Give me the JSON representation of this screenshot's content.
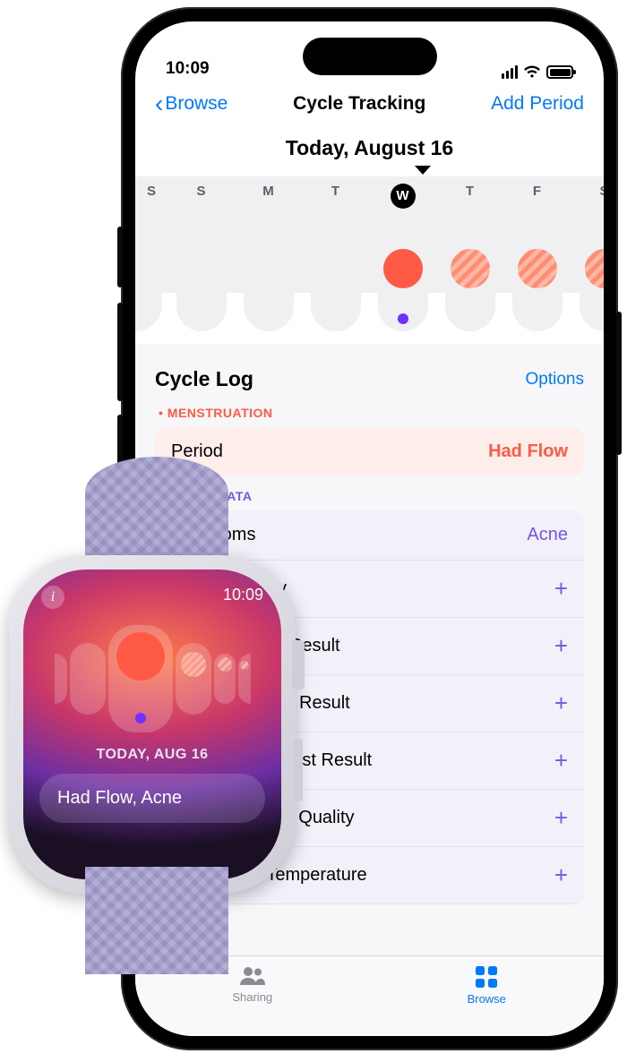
{
  "phone": {
    "status": {
      "time": "10:09"
    },
    "nav": {
      "back": "Browse",
      "title": "Cycle Tracking",
      "action": "Add Period"
    },
    "dateHeading": "Today, August 16",
    "dayLabels": [
      "S",
      "S",
      "M",
      "T",
      "W",
      "T",
      "F",
      "S"
    ],
    "selectedIndex": 4,
    "cycleLog": {
      "title": "Cycle Log",
      "options": "Options",
      "menstruationLabel": "MENSTRUATION",
      "periodRow": {
        "label": "Period",
        "value": "Had Flow"
      },
      "otherLabel": "OTHER DATA",
      "rows": [
        {
          "label": "Symptoms",
          "value": "Acne"
        },
        {
          "label": "Sexual Activity",
          "value": "+"
        },
        {
          "label": "Ovulation Test Result",
          "value": "+"
        },
        {
          "label": "Pregnancy Test Result",
          "value": "+"
        },
        {
          "label": "Progesterone Test Result",
          "value": "+"
        },
        {
          "label": "Cervical Mucus Quality",
          "value": "+"
        },
        {
          "label": "Basal Body Temperature",
          "value": "+"
        }
      ]
    },
    "tabs": {
      "sharing": "Sharing",
      "browse": "Browse"
    }
  },
  "watch": {
    "time": "10:09",
    "date": "TODAY, AUG 16",
    "chip": "Had Flow, Acne"
  },
  "colors": {
    "accent": "#007aff",
    "period": "#ff5a45",
    "other": "#7755e5"
  }
}
